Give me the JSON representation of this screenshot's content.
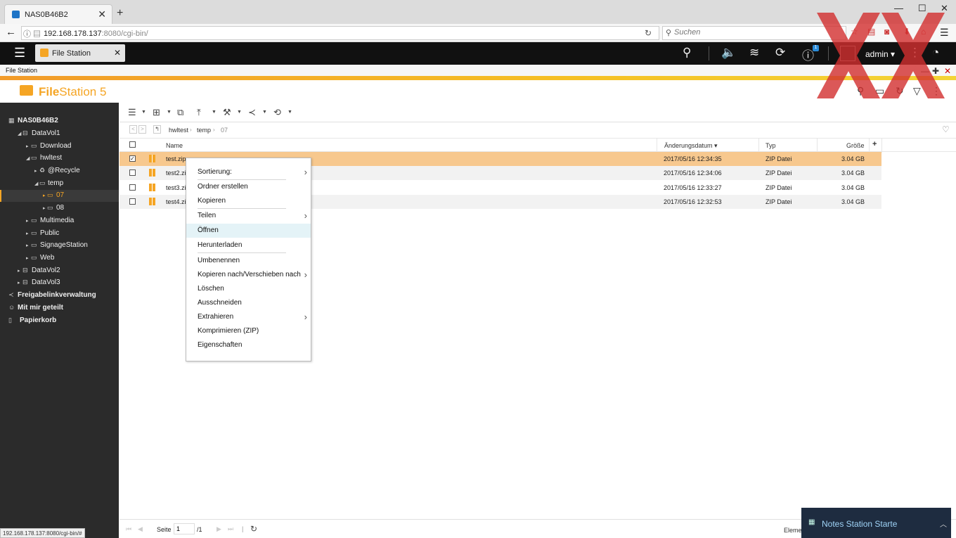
{
  "browser": {
    "tab_title": "NAS0B46B2",
    "url_host": "192.168.178.137",
    "url_path": ":8080/cgi-bin/",
    "search_placeholder": "Suchen",
    "status_url": "192.168.178.137:8080/cgi-bin/#"
  },
  "qts": {
    "app_tab": "File Station",
    "user": "admin",
    "notification_count": "1"
  },
  "app": {
    "title": "File Station",
    "brand_bold": "File",
    "brand_rest": "Station 5"
  },
  "sidebar": {
    "nas": "NAS0B46B2",
    "items": [
      {
        "label": "DataVol1"
      },
      {
        "label": "Download"
      },
      {
        "label": "hwltest"
      },
      {
        "label": "@Recycle"
      },
      {
        "label": "temp"
      },
      {
        "label": "07"
      },
      {
        "label": "08"
      },
      {
        "label": "Multimedia"
      },
      {
        "label": "Public"
      },
      {
        "label": "SignageStation"
      },
      {
        "label": "Web"
      },
      {
        "label": "DataVol2"
      },
      {
        "label": "DataVol3"
      }
    ],
    "share_links": "Freigabelinkverwaltung",
    "shared_with_me": "Mit mir geteilt",
    "recycle_bin": "Papierkorb"
  },
  "breadcrumb": [
    "hwltest",
    "temp",
    "07"
  ],
  "table": {
    "headers": {
      "name": "Name",
      "date": "Änderungsdatum",
      "type": "Typ",
      "size": "Größe"
    },
    "rows": [
      {
        "name": "test.zip",
        "date": "2017/05/16 12:34:35",
        "type": "ZIP Datei",
        "size": "3.04 GB"
      },
      {
        "name": "test2.zi",
        "date": "2017/05/16 12:34:06",
        "type": "ZIP Datei",
        "size": "3.04 GB"
      },
      {
        "name": "test3.zi",
        "date": "2017/05/16 12:33:27",
        "type": "ZIP Datei",
        "size": "3.04 GB"
      },
      {
        "name": "test4.zi",
        "date": "2017/05/16 12:32:53",
        "type": "ZIP Datei",
        "size": "3.04 GB"
      }
    ]
  },
  "context_menu": {
    "items": [
      {
        "label": "Sortierung:"
      },
      {
        "label": "Ordner erstellen"
      },
      {
        "label": "Kopieren"
      },
      {
        "label": "Teilen"
      },
      {
        "label": "Öffnen"
      },
      {
        "label": "Herunterladen"
      },
      {
        "label": "Umbenennen"
      },
      {
        "label": "Kopieren nach/Verschieben nach"
      },
      {
        "label": "Löschen"
      },
      {
        "label": "Ausschneiden"
      },
      {
        "label": "Extrahieren"
      },
      {
        "label": "Komprimieren (ZIP)"
      },
      {
        "label": "Eigenschaften"
      }
    ]
  },
  "footer": {
    "page_label": "Seite",
    "page_value": "1",
    "page_total": "/1",
    "elements_label": "Elemen",
    "notes_text": "Notes Station Starte"
  },
  "colors": {
    "accent": "#f5a524",
    "selected_row": "#f7c88e",
    "sidebar_bg": "#2b2b2b",
    "hover_item": "#e4f3f7"
  }
}
